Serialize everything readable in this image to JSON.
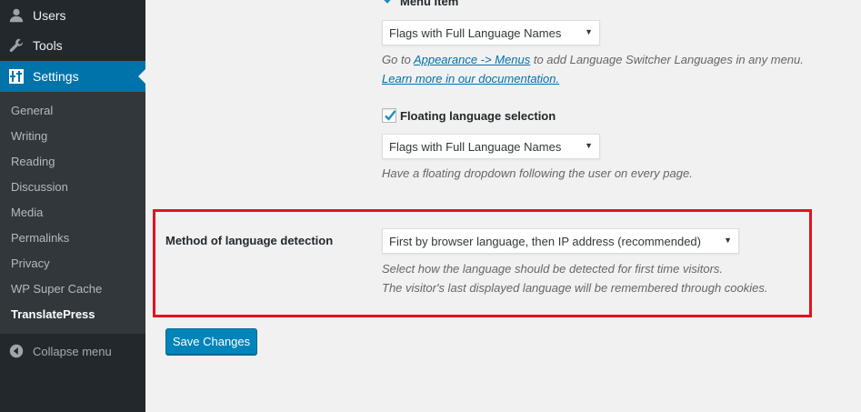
{
  "sidebar": {
    "top_items": [
      {
        "label": "Users",
        "icon": "users-icon"
      },
      {
        "label": "Tools",
        "icon": "wrench-icon"
      },
      {
        "label": "Settings",
        "icon": "settings-icon"
      }
    ],
    "submenu": [
      "General",
      "Writing",
      "Reading",
      "Discussion",
      "Media",
      "Permalinks",
      "Privacy",
      "WP Super Cache",
      "TranslatePress"
    ],
    "collapse_label": "Collapse menu"
  },
  "menu_item": {
    "label": "Menu Item",
    "select_value": "Flags with Full Language Names",
    "desc_prefix": "Go to ",
    "desc_link": "Appearance -> Menus",
    "desc_suffix": " to add Language Switcher Languages in any menu.",
    "doc_link": "Learn more in our documentation."
  },
  "floating": {
    "label": "Floating language selection",
    "select_value": "Flags with Full Language Names",
    "desc": "Have a floating dropdown following the user on every page."
  },
  "detection": {
    "label": "Method of language detection",
    "select_value": "First by browser language, then IP address (recommended)",
    "desc_line1": "Select how the language should be detected for first time visitors.",
    "desc_line2": "The visitor's last displayed language will be remembered through cookies."
  },
  "save_label": "Save Changes",
  "colors": {
    "sidebar_bg": "#23282d",
    "submenu_bg": "#32373c",
    "accent": "#0073aa",
    "button": "#0085ba",
    "highlight": "#e5121c"
  }
}
